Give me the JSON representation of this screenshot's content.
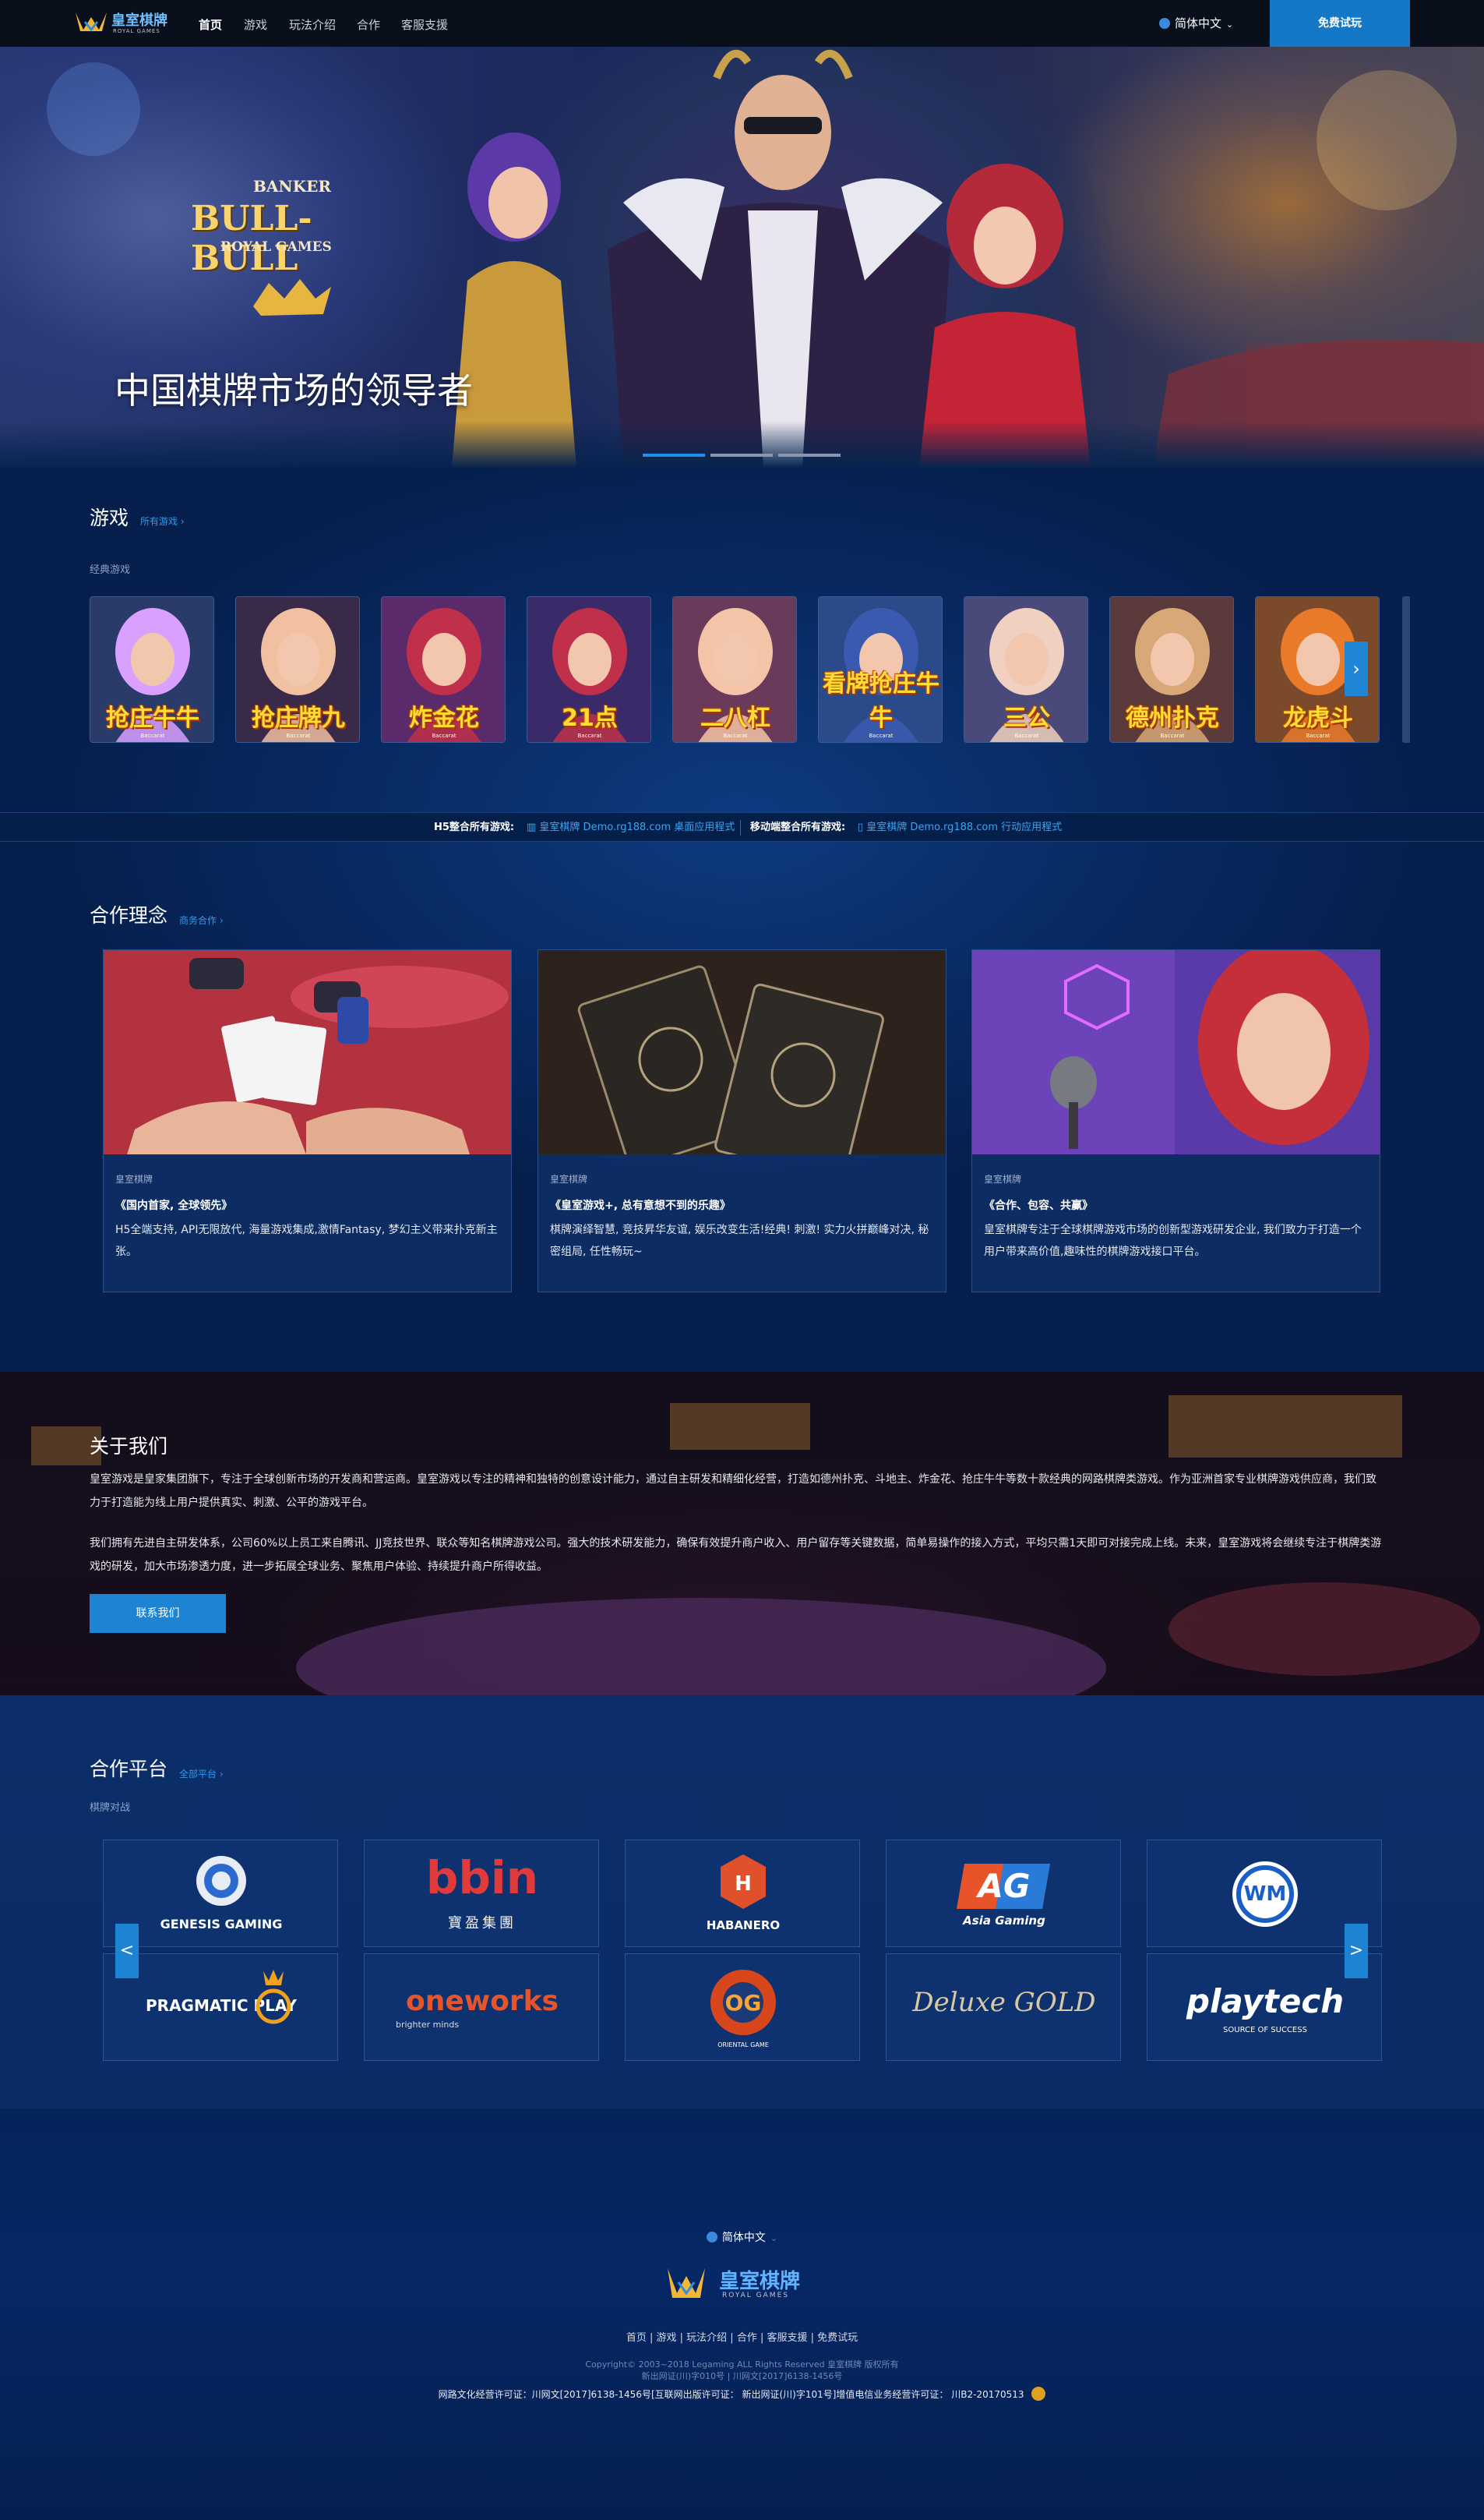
{
  "nav": {
    "logo_text": "皇室棋牌",
    "logo_sub": "ROYAL GAMES",
    "items": [
      "首页",
      "游戏",
      "玩法介绍",
      "合作",
      "客服支援"
    ],
    "language": "简体中文",
    "trial_button": "免费试玩"
  },
  "hero": {
    "title": "中国棋牌市场的领导者",
    "logo_line1": "BANKER",
    "logo_line2": "BULL-BULL",
    "logo_line3": "ROYAL GAMES",
    "slides": 3,
    "active_slide": 0
  },
  "games": {
    "title": "游戏",
    "all_link": "所有游戏",
    "subtitle": "经典游戏",
    "items": [
      {
        "name": "抢庄牛牛",
        "tag": "Baccarat"
      },
      {
        "name": "抢庄牌九",
        "tag": "Baccarat"
      },
      {
        "name": "炸金花",
        "tag": "Baccarat"
      },
      {
        "name": "21点",
        "tag": "Baccarat"
      },
      {
        "name": "二八杠",
        "tag": "Baccarat"
      },
      {
        "name": "看牌抢庄牛牛",
        "tag": "Baccarat"
      },
      {
        "name": "三公",
        "tag": "Baccarat"
      },
      {
        "name": "德州扑克",
        "tag": "Baccarat"
      },
      {
        "name": "龙虎斗",
        "tag": "Baccarat"
      }
    ],
    "next": "›"
  },
  "platform_bar": {
    "h5_label": "H5整合所有游戏:",
    "h5_link": "皇室棋牌 Demo.rg188.com 桌面应用程式",
    "mobile_label": "移动端整合所有游戏:",
    "mobile_link": "皇室棋牌 Demo.rg188.com 行动应用程式"
  },
  "philosophy": {
    "title": "合作理念",
    "link": "商务合作",
    "cards": [
      {
        "category": "皇室棋牌",
        "title": "《国内首家, 全球领先》",
        "text": "H5全端支持, API无限放代, 海量游戏集成,激情Fantasy, 梦幻主义带来扑克新主张。"
      },
      {
        "category": "皇室棋牌",
        "title": "《皇室游戏+, 总有意想不到的乐趣》",
        "text": "棋牌演绎智慧, 竞技昇华友谊, 娱乐改变生活!经典! 刺激! 实力火拼巅峰对决, 秘密组局, 任性畅玩~"
      },
      {
        "category": "皇室棋牌",
        "title": "《合作、包容、共赢》",
        "text": "皇室棋牌专注于全球棋牌游戏市场的创新型游戏研发企业, 我们致力于打造一个用户带来高价值,趣味性的棋牌游戏接口平台。"
      }
    ]
  },
  "about": {
    "title": "关于我们",
    "p1": "皇室游戏是皇家集团旗下，专注于全球创新市场的开发商和营运商。皇室游戏以专注的精神和独特的创意设计能力，通过自主研发和精细化经营，打造如德州扑克、斗地主、炸金花、抢庄牛牛等数十款经典的网路棋牌类游戏。作为亚洲首家专业棋牌游戏供应商，我们致力于打造能为线上用户提供真实、刺激、公平的游戏平台。",
    "p2": "我们拥有先进自主研发体系，公司60%以上员工来自腾讯、JJ竞技世界、联众等知名棋牌游戏公司。强大的技术研发能力，确保有效提升商户收入、用户留存等关键数据，简单易操作的接入方式，平均只需1天即可对接完成上线。未来，皇室游戏将会继续专注于棋牌类游戏的研发，加大市场渗透力度，进一步拓展全球业务、聚焦用户体验、持续提升商户所得收益。",
    "button": "联系我们"
  },
  "partners": {
    "title": "合作平台",
    "link": "全部平台",
    "subtitle": "棋牌对战",
    "logos": [
      {
        "name": "GENESIS GAMING"
      },
      {
        "name": "bbin",
        "sub": "寶盈集團"
      },
      {
        "name": "HABANERO"
      },
      {
        "name": "AG",
        "sub": "Asia Gaming"
      },
      {
        "name": "WM"
      },
      {
        "name": "PRAGMATIC PLAY"
      },
      {
        "name": "oneworks",
        "sub": "brighter minds"
      },
      {
        "name": "OG",
        "sub": "ORIENTAL GAME"
      },
      {
        "name": "Deluxe GOLD"
      },
      {
        "name": "playtech",
        "sub": "SOURCE OF SUCCESS"
      }
    ],
    "prev": "<",
    "next": ">"
  },
  "footer": {
    "language": "简体中文",
    "logo_text": "皇室棋牌",
    "logo_sub": "ROYAL GAMES",
    "links": [
      "首页",
      "游戏",
      "玩法介绍",
      "合作",
      "客服支援",
      "免费试玩"
    ],
    "copyright": "Copyright© 2003~2018 Legaming ALL Rights Reserved 皇室棋牌 版权所有",
    "record1": "新出网证(川)字010号 | 川网文[2017]6138-1456号",
    "license_a_label": "网路文化经营许可证：",
    "license_a": "川网文[2017]6138-1456号[互联网出版许可证：",
    "license_b": "新出网证(川)字101号]增值电信业务经营许可证：",
    "license_c": "川B2-20170513"
  },
  "colors": {
    "accent": "#1478c8",
    "bg": "#06265a",
    "gold": "#ffdd35"
  }
}
